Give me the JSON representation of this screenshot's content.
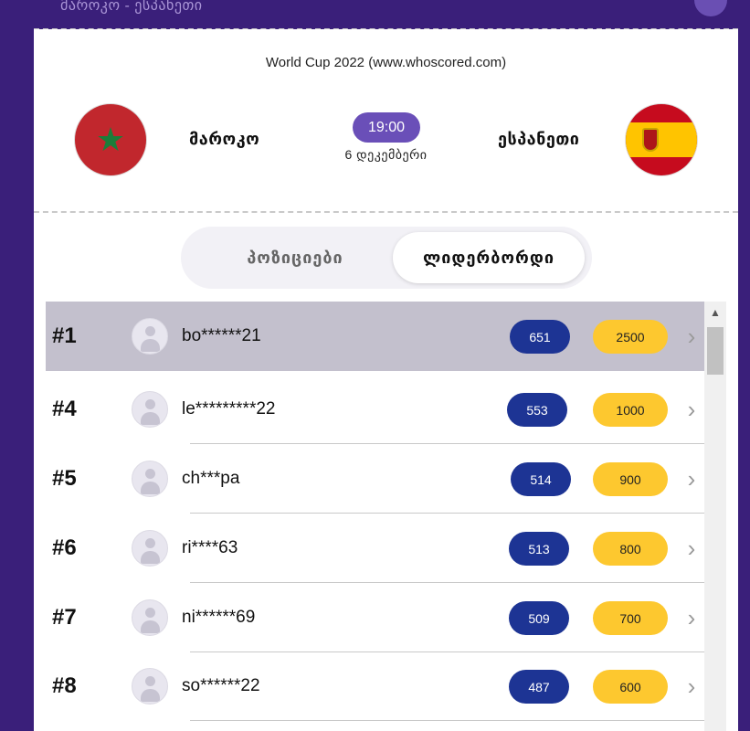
{
  "header": {
    "match_title": "მაროკო - ესპანეთი"
  },
  "match": {
    "tournament": "World Cup 2022 (www.whoscored.com)",
    "home_team": "მაროკო",
    "away_team": "ესპანეთი",
    "time": "19:00",
    "date": "6 დეკემბერი",
    "home_flag_icon": "morocco-flag-icon",
    "away_flag_icon": "spain-flag-icon"
  },
  "tabs": [
    {
      "label": "პოზიციები",
      "active": false
    },
    {
      "label": "ლიდერბორდი",
      "active": true
    }
  ],
  "leaderboard": [
    {
      "rank": "#1",
      "user": "bo******21",
      "points": "651",
      "coins": "2500",
      "highlighted": true
    },
    {
      "rank": "#4",
      "user": "le*********22",
      "points": "553",
      "coins": "1000",
      "highlighted": false
    },
    {
      "rank": "#5",
      "user": "ch***pa",
      "points": "514",
      "coins": "900",
      "highlighted": false
    },
    {
      "rank": "#6",
      "user": "ri****63",
      "points": "513",
      "coins": "800",
      "highlighted": false
    },
    {
      "rank": "#7",
      "user": "ni******69",
      "points": "509",
      "coins": "700",
      "highlighted": false
    },
    {
      "rank": "#8",
      "user": "so******22",
      "points": "487",
      "coins": "600",
      "highlighted": false
    }
  ],
  "colors": {
    "background": "#3a1f7a",
    "accent": "#6a4fb8",
    "points_pill": "#1d3494",
    "coins_pill": "#fdc82f",
    "highlight_row": "#c3c0cd"
  }
}
